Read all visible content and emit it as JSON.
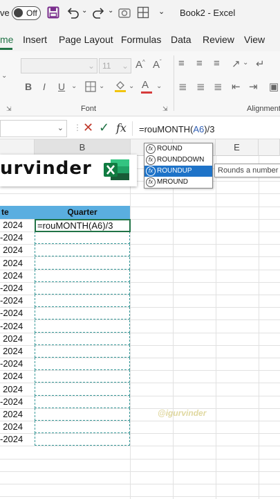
{
  "titlebar": {
    "autosave_label": "ve",
    "toggle_label": "Off",
    "title": "Book2 - Excel"
  },
  "tabs": [
    "me",
    "Insert",
    "Page Layout",
    "Formulas",
    "Data",
    "Review",
    "View"
  ],
  "ribbon": {
    "font_size": "11",
    "font_group": "Font",
    "alignment_group": "Alignment"
  },
  "formula_bar": {
    "fx_label": "fx",
    "formula_prefix": "=rouMONTH(",
    "formula_ref": "A6",
    "formula_suffix": ")/3"
  },
  "columns": [
    "B",
    "E"
  ],
  "banner": {
    "text": "urvinder"
  },
  "table": {
    "header_a": "te",
    "header_b": "Quarter",
    "active_formula": "=rouMONTH(A6)/3",
    "rows": [
      "2024",
      "-2024",
      "2024",
      "2024",
      "2024",
      "-2024",
      "-2024",
      "-2024",
      "-2024",
      "2024",
      "2024",
      "-2024",
      "2024",
      "2024",
      "-2024",
      "2024",
      "2024",
      "-2024"
    ]
  },
  "autocomplete": {
    "items": [
      "ROUND",
      "ROUNDDOWN",
      "ROUNDUP",
      "MROUND"
    ],
    "selected_index": 2,
    "tooltip": "Rounds a number up, away from zero"
  },
  "watermark": "@igurvinder",
  "colors": {
    "accent": "#217346",
    "header_fill": "#5aaee0",
    "selection": "#1e73c8"
  }
}
